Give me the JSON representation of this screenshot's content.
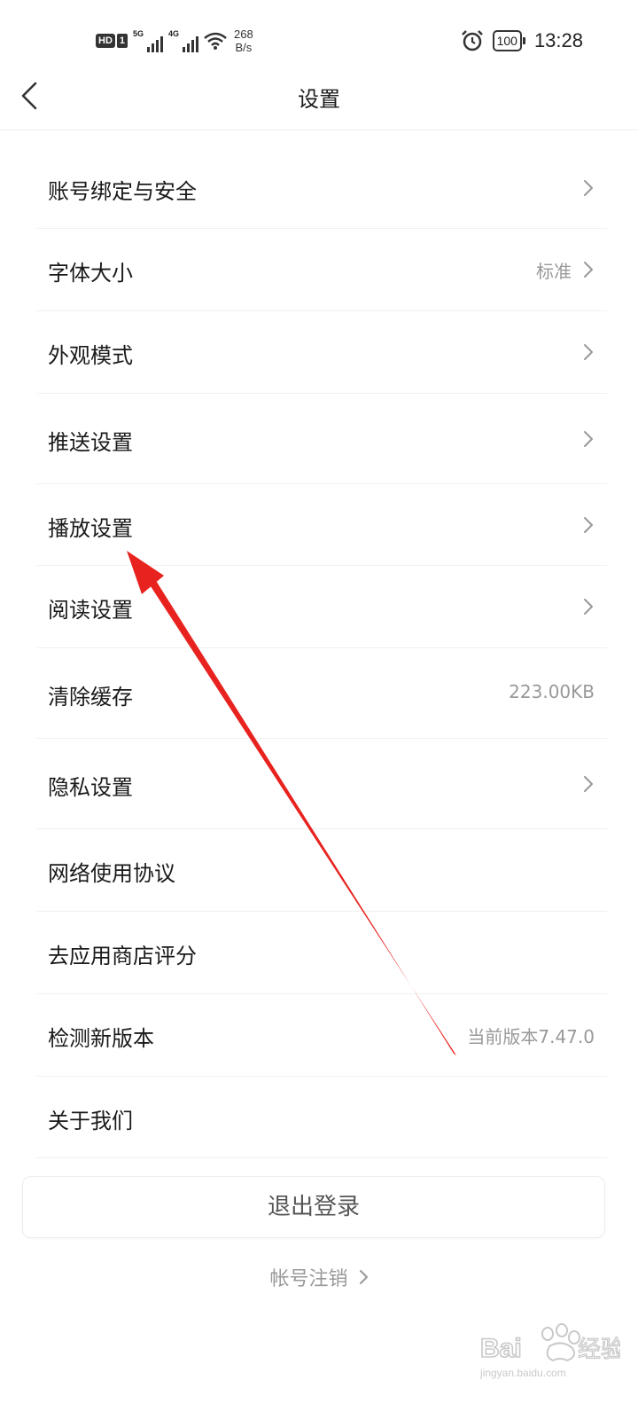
{
  "status_bar": {
    "hd_label": "HD",
    "sim_label": "1",
    "signal_1_label": "5G",
    "signal_2_label": "4G",
    "net_speed_value": "268",
    "net_speed_unit": "B/s",
    "battery_level": "100",
    "time": "13:28"
  },
  "nav": {
    "title": "设置"
  },
  "settings": [
    {
      "label": "账号绑定与安全",
      "value": "",
      "chevron": true
    },
    {
      "label": "字体大小",
      "value": "标准",
      "chevron": true
    },
    {
      "label": "外观模式",
      "value": "",
      "chevron": true
    },
    {
      "label": "推送设置",
      "value": "",
      "chevron": true
    },
    {
      "label": "播放设置",
      "value": "",
      "chevron": true
    },
    {
      "label": "阅读设置",
      "value": "",
      "chevron": true
    },
    {
      "label": "清除缓存",
      "value": "223.00KB",
      "chevron": false
    },
    {
      "label": "隐私设置",
      "value": "",
      "chevron": true
    },
    {
      "label": "网络使用协议",
      "value": "",
      "chevron": false
    },
    {
      "label": "去应用商店评分",
      "value": "",
      "chevron": false
    },
    {
      "label": "检测新版本",
      "value": "当前版本7.47.0",
      "chevron": false
    },
    {
      "label": "关于我们",
      "value": "",
      "chevron": false
    }
  ],
  "logout_label": "退出登录",
  "cancel_account_label": "帐号注销",
  "watermark": {
    "brand": "Bai du 经验",
    "url": "jingyan.baidu.com"
  },
  "colors": {
    "annotation_arrow": "#e8231f",
    "secondary_text": "#999999"
  }
}
